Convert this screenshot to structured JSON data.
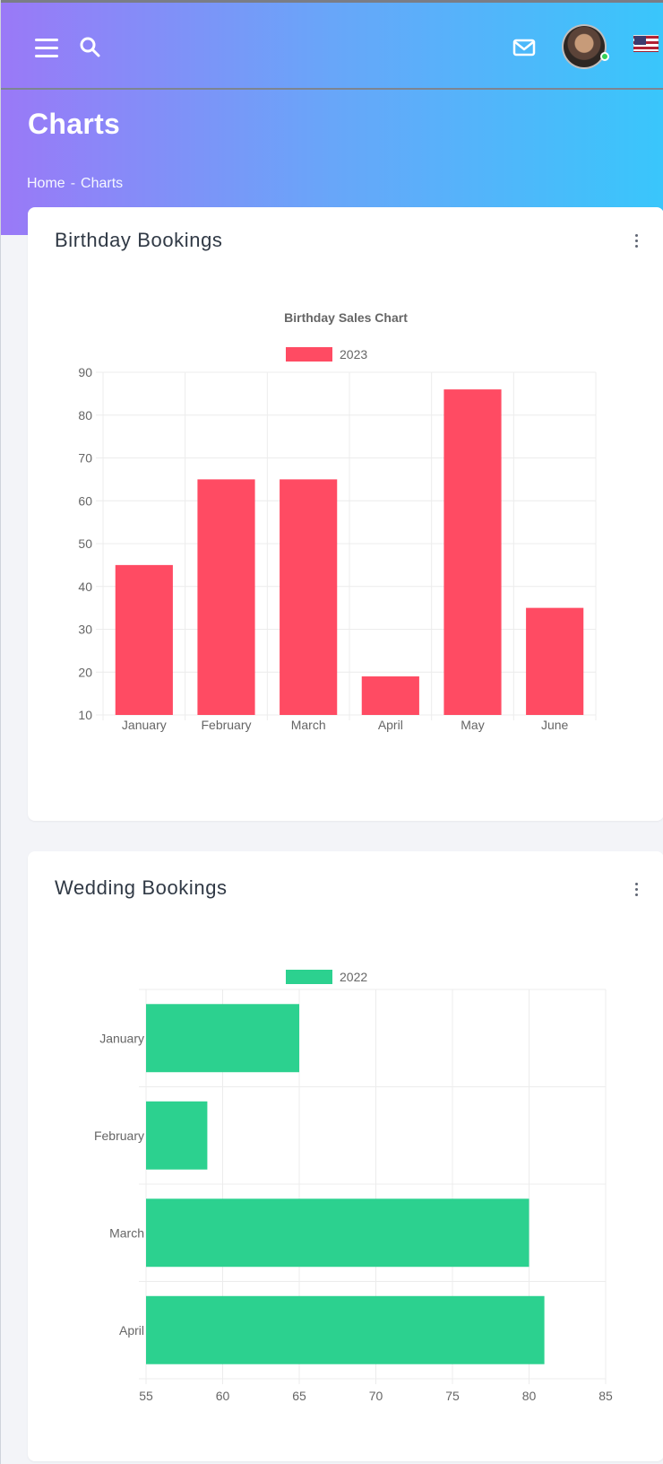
{
  "header": {
    "icons": [
      "menu-icon",
      "search-icon",
      "mail-icon",
      "avatar",
      "us-flag-icon"
    ]
  },
  "page": {
    "title": "Charts",
    "breadcrumb": [
      "Home",
      "-",
      "Charts"
    ]
  },
  "colors": {
    "gradient_start": "#9a79f7",
    "gradient_mid": "#68a6f9",
    "gradient_end": "#39c6fb",
    "birthday_bar": "#ff4b63",
    "wedding_bar": "#2cd18f"
  },
  "cards": [
    {
      "title": "Birthday Bookings",
      "menu_icon": "kebab-menu-icon"
    },
    {
      "title": "Wedding Bookings",
      "menu_icon": "kebab-menu-icon"
    }
  ],
  "chart_data": [
    {
      "type": "bar",
      "title": "Birthday Sales Chart",
      "categories": [
        "January",
        "February",
        "March",
        "April",
        "May",
        "June"
      ],
      "series": [
        {
          "name": "2023",
          "values": [
            45,
            65,
            65,
            19,
            86,
            35
          ]
        }
      ],
      "ylim": [
        10,
        90
      ],
      "yticks": [
        90,
        80,
        70,
        60,
        50,
        40,
        30,
        20,
        10
      ],
      "grid": true,
      "legend": "top-center"
    },
    {
      "type": "bar",
      "orientation": "horizontal",
      "categories": [
        "January",
        "February",
        "March",
        "April"
      ],
      "series": [
        {
          "name": "2022",
          "values": [
            65,
            59,
            80,
            81
          ]
        }
      ],
      "xlim": [
        55,
        85
      ],
      "xticks": [
        55,
        60,
        65,
        70,
        75,
        80,
        85
      ],
      "grid": true,
      "legend": "top-center"
    }
  ]
}
